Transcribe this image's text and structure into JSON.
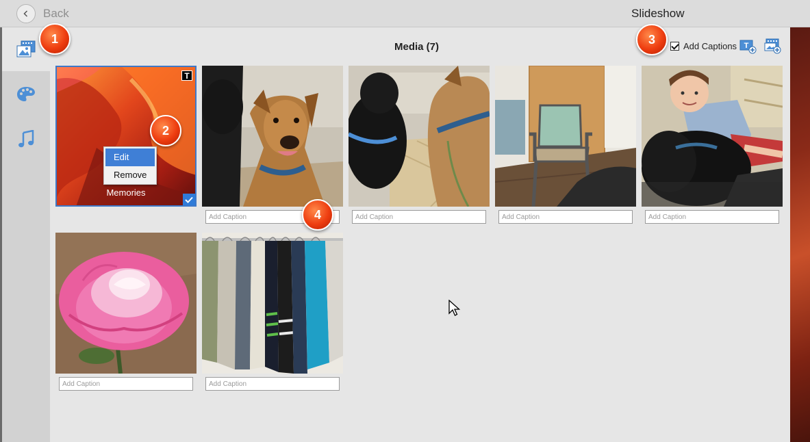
{
  "window": {
    "title": "Slideshow",
    "back_label": "Back"
  },
  "sidebar": {
    "items": [
      {
        "icon": "media-icon",
        "active": true
      },
      {
        "icon": "palette-icon",
        "active": false
      },
      {
        "icon": "music-icon",
        "active": false
      }
    ]
  },
  "main": {
    "title": "Media (7)",
    "add_captions_label": "Add Captions",
    "add_captions_checked": true
  },
  "tiles": [
    {
      "subject": "orange-canyon",
      "title_text": "Memories",
      "has_text_badge": true,
      "text_badge": "T",
      "selected": true,
      "caption_placeholder": ""
    },
    {
      "subject": "dogs-in-car",
      "caption_placeholder": "Add Caption"
    },
    {
      "subject": "dogs-from-behind",
      "caption_placeholder": "Add Caption"
    },
    {
      "subject": "waiting-room-chair",
      "caption_placeholder": "Add Caption"
    },
    {
      "subject": "boy-with-dog",
      "caption_placeholder": "Add Caption"
    },
    {
      "subject": "pink-rose",
      "caption_placeholder": "Add Caption"
    },
    {
      "subject": "clothes-rack",
      "caption_placeholder": "Add Caption"
    }
  ],
  "context_menu": {
    "items": [
      "Edit",
      "Remove"
    ],
    "highlighted": "Edit"
  },
  "callouts": [
    "1",
    "2",
    "3",
    "4"
  ],
  "colors": {
    "accent": "#3f7fd6",
    "callout": "#ee3d10"
  }
}
